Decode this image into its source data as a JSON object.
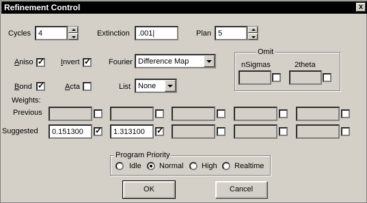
{
  "window": {
    "title": "Refinement Control",
    "close_label": "x"
  },
  "cycles": {
    "label": "Cycles",
    "value": "4"
  },
  "extinction": {
    "label": "Extinction",
    "value": ".001|"
  },
  "plan": {
    "label": "Plan",
    "value": "5"
  },
  "aniso": {
    "label_first": "A",
    "label_rest": "niso",
    "checked": true
  },
  "invert": {
    "label_first": "I",
    "label_rest": "nvert",
    "checked": true
  },
  "fourier": {
    "label": "Fourier",
    "selected": "Difference Map"
  },
  "omit": {
    "title": "Omit",
    "nsigmas_label": "nSigmas",
    "twotheta_label": "2theta",
    "nsigmas_checked": false,
    "twotheta_checked": false
  },
  "bond": {
    "label_first": "B",
    "label_rest": "ond",
    "checked": true
  },
  "acta": {
    "label_first": "A",
    "label_rest": "cta",
    "checked": false
  },
  "list": {
    "label": "List",
    "selected": "None"
  },
  "weights": {
    "title": "Weights:",
    "previous_label": "Previous",
    "suggested_label": "Suggested",
    "previous": [
      {
        "value": "",
        "checked": false
      },
      {
        "value": "",
        "checked": false
      },
      {
        "value": "",
        "checked": false
      },
      {
        "value": "",
        "checked": false
      },
      {
        "value": "",
        "checked": false
      }
    ],
    "suggested": [
      {
        "value": "0.151300",
        "checked": true
      },
      {
        "value": "1.313100",
        "checked": true
      },
      {
        "value": "",
        "checked": false
      },
      {
        "value": "",
        "checked": false
      },
      {
        "value": "",
        "checked": false
      }
    ]
  },
  "priority": {
    "title": "Program Priority",
    "options": [
      {
        "label": "Idle",
        "selected": false
      },
      {
        "label": "Normal",
        "selected": true
      },
      {
        "label": "High",
        "selected": false
      },
      {
        "label": "Realtime",
        "selected": false
      }
    ]
  },
  "buttons": {
    "ok": "OK",
    "cancel": "Cancel"
  }
}
